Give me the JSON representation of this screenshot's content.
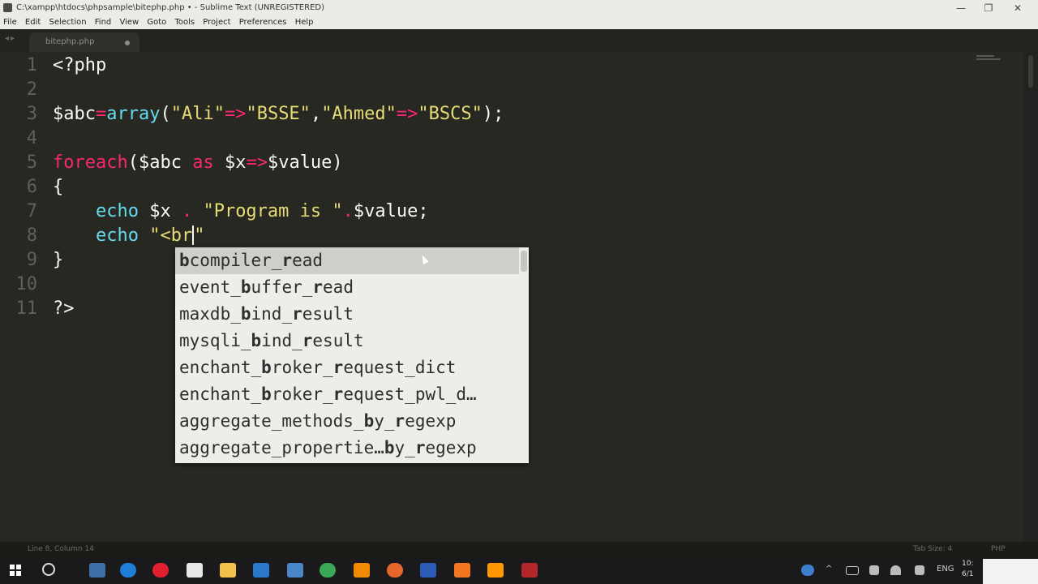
{
  "window": {
    "title": "C:\\xampp\\htdocs\\phpsample\\bitephp.php • - Sublime Text (UNREGISTERED)",
    "controls": [
      "—",
      "❐",
      "✕"
    ]
  },
  "menu": [
    "File",
    "Edit",
    "Selection",
    "Find",
    "View",
    "Goto",
    "Tools",
    "Project",
    "Preferences",
    "Help"
  ],
  "tab": {
    "name": "bitephp.php",
    "modified": true
  },
  "editor": {
    "lines": [
      {
        "num": "1",
        "segments": [
          {
            "t": "<?php",
            "c": "var"
          }
        ]
      },
      {
        "num": "2",
        "segments": []
      },
      {
        "num": "3",
        "segments": [
          {
            "t": "$abc",
            "c": "var"
          },
          {
            "t": "=",
            "c": "kw"
          },
          {
            "t": "array",
            "c": "fn"
          },
          {
            "t": "(",
            "c": "var"
          },
          {
            "t": "\"Ali\"",
            "c": "str"
          },
          {
            "t": "=>",
            "c": "kw"
          },
          {
            "t": "\"BSSE\"",
            "c": "str"
          },
          {
            "t": ",",
            "c": "var"
          },
          {
            "t": "\"Ahmed\"",
            "c": "str"
          },
          {
            "t": "=>",
            "c": "kw"
          },
          {
            "t": "\"BSCS\"",
            "c": "str"
          },
          {
            "t": ");",
            "c": "var"
          }
        ]
      },
      {
        "num": "4",
        "segments": []
      },
      {
        "num": "5",
        "segments": [
          {
            "t": "foreach",
            "c": "kw"
          },
          {
            "t": "($abc ",
            "c": "var"
          },
          {
            "t": "as",
            "c": "kw"
          },
          {
            "t": " $x",
            "c": "var"
          },
          {
            "t": "=>",
            "c": "kw"
          },
          {
            "t": "$value)",
            "c": "var"
          }
        ]
      },
      {
        "num": "6",
        "segments": [
          {
            "t": "{",
            "c": "var"
          }
        ]
      },
      {
        "num": "7",
        "segments": [
          {
            "t": "    ",
            "c": "var"
          },
          {
            "t": "echo",
            "c": "fn"
          },
          {
            "t": " $x ",
            "c": "var"
          },
          {
            "t": ".",
            "c": "kw"
          },
          {
            "t": " ",
            "c": "var"
          },
          {
            "t": "\"Program is \"",
            "c": "str"
          },
          {
            "t": ".",
            "c": "kw"
          },
          {
            "t": "$value;",
            "c": "var"
          }
        ]
      },
      {
        "num": "8",
        "segments": [
          {
            "t": "    ",
            "c": "var"
          },
          {
            "t": "echo",
            "c": "fn"
          },
          {
            "t": " ",
            "c": "var"
          },
          {
            "t": "\"<br",
            "c": "str"
          },
          {
            "t": "",
            "c": "cursor"
          },
          {
            "t": "\"",
            "c": "str"
          }
        ]
      },
      {
        "num": "9",
        "segments": [
          {
            "t": "}",
            "c": "var"
          }
        ]
      },
      {
        "num": "10",
        "segments": []
      },
      {
        "num": "11",
        "segments": [
          {
            "t": "?>",
            "c": "var"
          }
        ]
      }
    ]
  },
  "autocomplete": {
    "items": [
      {
        "parts": [
          [
            "b",
            true
          ],
          [
            "compiler_",
            false
          ],
          [
            "r",
            true
          ],
          [
            "ead",
            false
          ]
        ]
      },
      {
        "parts": [
          [
            "event_",
            false
          ],
          [
            "b",
            true
          ],
          [
            "uffer_",
            false
          ],
          [
            "r",
            true
          ],
          [
            "ead",
            false
          ]
        ]
      },
      {
        "parts": [
          [
            "maxdb_",
            false
          ],
          [
            "b",
            true
          ],
          [
            "ind_",
            false
          ],
          [
            "r",
            true
          ],
          [
            "esult",
            false
          ]
        ]
      },
      {
        "parts": [
          [
            "mysqli_",
            false
          ],
          [
            "b",
            true
          ],
          [
            "ind_",
            false
          ],
          [
            "r",
            true
          ],
          [
            "esult",
            false
          ]
        ]
      },
      {
        "parts": [
          [
            "enchant_",
            false
          ],
          [
            "b",
            true
          ],
          [
            "roker_",
            false
          ],
          [
            "r",
            true
          ],
          [
            "equest_dict",
            false
          ]
        ]
      },
      {
        "parts": [
          [
            "enchant_",
            false
          ],
          [
            "b",
            true
          ],
          [
            "roker_",
            false
          ],
          [
            "r",
            true
          ],
          [
            "equest_pwl_d…",
            false
          ]
        ]
      },
      {
        "parts": [
          [
            "aggregate_methods_",
            false
          ],
          [
            "b",
            true
          ],
          [
            "y_",
            false
          ],
          [
            "r",
            true
          ],
          [
            "egexp",
            false
          ]
        ]
      },
      {
        "parts": [
          [
            "aggregate_propertie…",
            false
          ],
          [
            "b",
            true
          ],
          [
            "y_",
            false
          ],
          [
            "r",
            true
          ],
          [
            "egexp",
            false
          ]
        ]
      }
    ],
    "selected_index": 0
  },
  "status": {
    "position": "Line 8, Column 14",
    "tab_size": "Tab Size: 4",
    "syntax": "PHP"
  },
  "taskbar": {
    "language": "ENG",
    "clock_time": "10:",
    "clock_date": "6/1"
  }
}
